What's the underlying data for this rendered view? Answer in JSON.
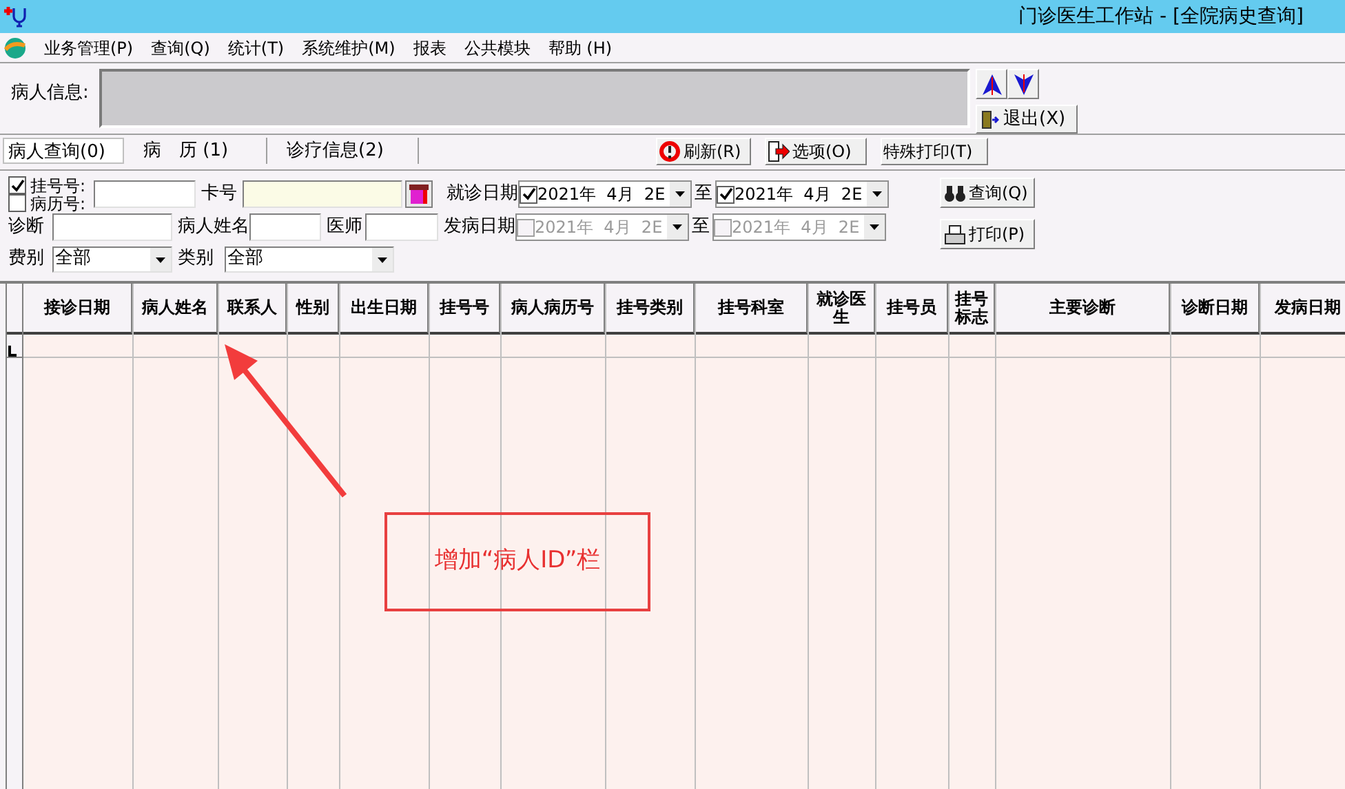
{
  "window": {
    "title": "门诊医生工作站 - [全院病史查询]"
  },
  "menu": [
    "业务管理(P)",
    "查询(Q)",
    "统计(T)",
    "系统维护(M)",
    "报表",
    "公共模块",
    "帮助 (H)"
  ],
  "patient_info": {
    "label": "病人信息:"
  },
  "exit_button": "退出(X)",
  "tabs": [
    {
      "label": "病人查询(0)",
      "selected": true
    },
    {
      "label": "病　历 (1)",
      "selected": false
    },
    {
      "label": "诊疗信息(2)",
      "selected": false
    }
  ],
  "toolbar": [
    "刷新(R)",
    "选项(O)",
    "特殊打印(T)"
  ],
  "filters": {
    "reg_no": {
      "label": "挂号号:",
      "checked": true
    },
    "record_no": {
      "label": "病历号:",
      "checked": false
    },
    "card_label": "卡号",
    "visit_date": {
      "label": "就诊日期",
      "from": {
        "value": "2021年  4月  2E",
        "checked": true,
        "disabled": false
      },
      "sep": "至",
      "to": {
        "value": "2021年  4月  2E",
        "checked": true,
        "disabled": false
      }
    },
    "diagnosis_label": "诊断",
    "name_label": "病人姓名",
    "doctor_label": "医师",
    "onset_date": {
      "label": "发病日期",
      "from": {
        "value": "2021年  4月  2E",
        "checked": false,
        "disabled": true
      },
      "sep": "至",
      "to": {
        "value": "2021年  4月  2E",
        "checked": false,
        "disabled": true
      }
    },
    "fee_type": {
      "label": "费别",
      "value": "全部"
    },
    "category": {
      "label": "类别",
      "value": "全部"
    }
  },
  "actions": [
    "查询(Q)",
    "打印(P)"
  ],
  "table": {
    "columns": [
      "接诊日期",
      "病人姓名",
      "联系人",
      "性别",
      "出生日期",
      "挂号号",
      "病人病历号",
      "挂号类别",
      "挂号科室",
      "就诊医生",
      "挂号员",
      "挂号标志",
      "主要诊断",
      "诊断日期",
      "发病日期"
    ]
  },
  "annotation": {
    "text": "增加“病人ID”栏"
  }
}
